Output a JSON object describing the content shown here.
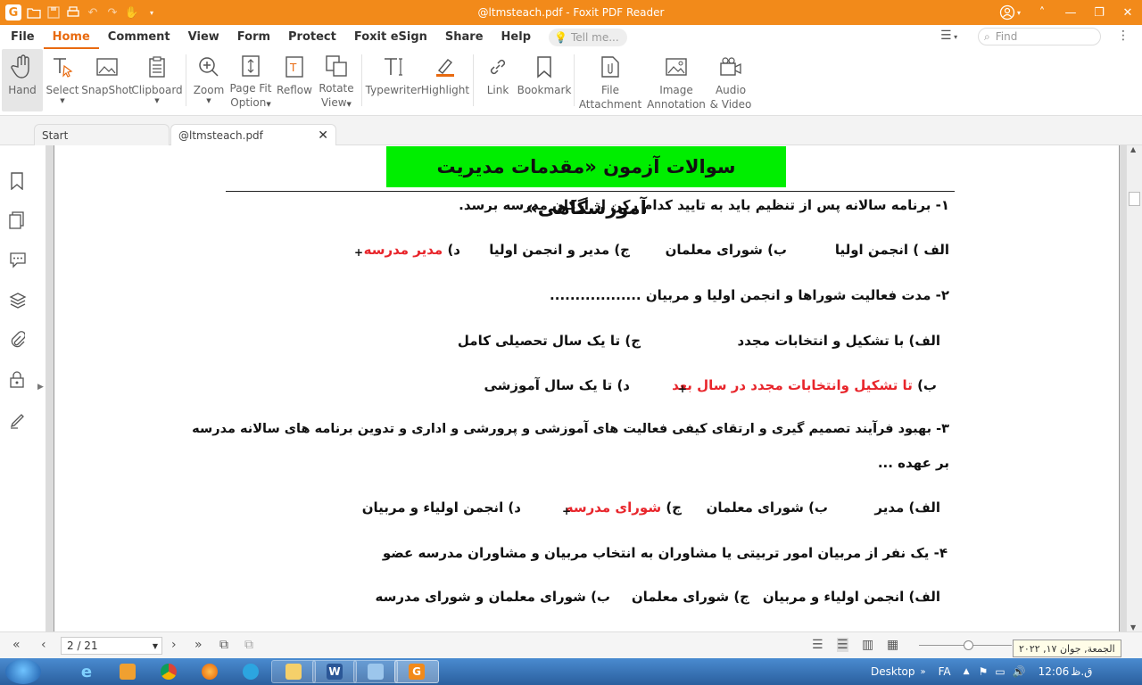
{
  "window": {
    "title": "@ltmsteach.pdf - Foxit PDF Reader"
  },
  "menu": {
    "tabs": [
      "File",
      "Home",
      "Comment",
      "View",
      "Form",
      "Protect",
      "Foxit eSign",
      "Share",
      "Help"
    ],
    "active_tab": "Home",
    "tell_me_placeholder": "Tell me...",
    "find_placeholder": "Find"
  },
  "ribbon": {
    "hand": "Hand",
    "select": "Select",
    "snapshot": "SnapShot",
    "clipboard": "Clipboard",
    "zoom": "Zoom",
    "page_fit_1": "Page Fit",
    "page_fit_2": "Option",
    "reflow": "Reflow",
    "rotate_1": "Rotate",
    "rotate_2": "View",
    "typewriter": "Typewriter",
    "highlight": "Highlight",
    "link": "Link",
    "bookmark": "Bookmark",
    "file_att_1": "File",
    "file_att_2": "Attachment",
    "image_ann_1": "Image",
    "image_ann_2": "Annotation",
    "audio_1": "Audio",
    "audio_2": "& Video"
  },
  "doc_tabs": {
    "start": "Start",
    "current": "@ltmsteach.pdf"
  },
  "document": {
    "heading": "سوالات آزمون «مقدمات مدیریت آموزشگاهی»",
    "q1": "۱- برنامه سالانه پس از تنظیم باید به تایید کدام رکن از ارکان مدرسه برسد.",
    "q1_a": "الف ) انجمن اولیا",
    "q1_b": "ب) شورای معلمان",
    "q1_c": "ج) مدیر و انجمن اولیا",
    "q1_d_prefix": "د)",
    "q1_d_answer": "مدیر مدرسه",
    "q2": "۲- مدت فعالیت شوراها و انجمن اولیا و مربیان ..................",
    "q2_a": "الف) با تشکیل و انتخابات مجدد",
    "q2_c": "ج) تا یک سال تحصیلی کامل",
    "q2_b_prefix": "ب)",
    "q2_b_answer": "تا تشکیل وانتخابات مجدد در سال بعد",
    "q2_d": "د) تا یک سال آموزشی",
    "q3_line1": "۳- بهبود فرآیند تصمیم گیری و ارتقای کیفی فعالیت های آموزشی و پرورشی و اداری و تدوین برنامه های سالانه مدرسه",
    "q3_line2": "بر عهده ...",
    "q3_a": "الف) مدیر",
    "q3_b": "ب) شورای معلمان",
    "q3_c_prefix": "ج)",
    "q3_c_answer": "شورای مدرسه",
    "q3_d": "د) انجمن اولیاء و مربیان",
    "q4": "۴-  یک نفر از مربیان امور تربیتی یا مشاوران به انتخاب مربیان و مشاوران مدرسه عضو",
    "q4_a": "الف) انجمن اولیاء و مربیان",
    "q4_c": "ج) شورای معلمان",
    "q4_b": "ب) شورای معلمان و شورای مدرسه",
    "plus": "+"
  },
  "status": {
    "page_indicator": "2 / 21",
    "date_tooltip": "الجمعة, جوان ١٧, ٢٠٢٢"
  },
  "taskbar": {
    "desktop_label": "Desktop",
    "lang": "FA",
    "time": "12:06",
    "ampm": "ق.ظ"
  },
  "colors": {
    "brand": "#f28a1a",
    "accent": "#e86a10",
    "answer_red": "#e8252b",
    "heading_bg": "#00ee00"
  }
}
